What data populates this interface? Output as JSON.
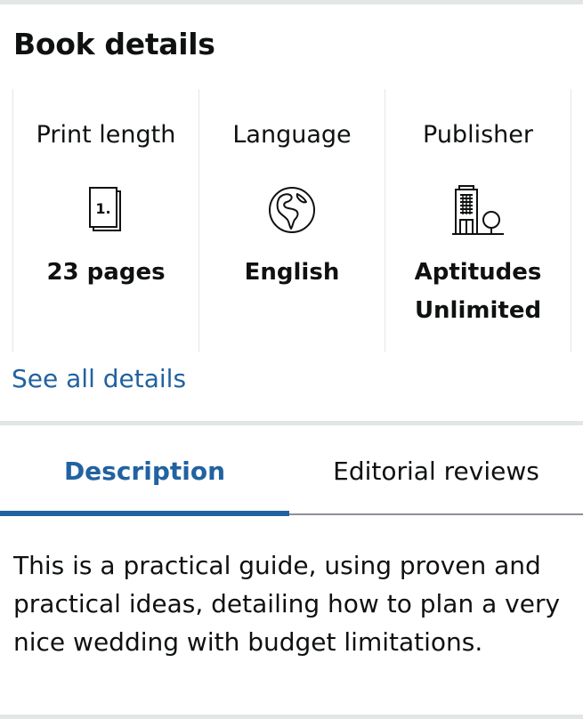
{
  "book_details": {
    "title": "Book details",
    "attributes": [
      {
        "label": "Print length",
        "icon": "page-icon",
        "value": "23 pages",
        "icon_glyph": "1."
      },
      {
        "label": "Language",
        "icon": "globe-icon",
        "value": "English"
      },
      {
        "label": "Publisher",
        "icon": "building-icon",
        "value": "Aptitudes Unlimited"
      }
    ],
    "see_all_link": "See all details"
  },
  "tabs": {
    "items": [
      {
        "label": "Description",
        "active": true
      },
      {
        "label": "Editorial reviews",
        "active": false
      }
    ]
  },
  "description": {
    "text": "This is a practical guide, using proven and practical ideas, detailing how to plan a very nice wedding with budget limitations."
  },
  "colors": {
    "link": "#2162a1",
    "text": "#0f1111",
    "divider": "#e3e6e6",
    "tab_rule": "#8d9096"
  }
}
